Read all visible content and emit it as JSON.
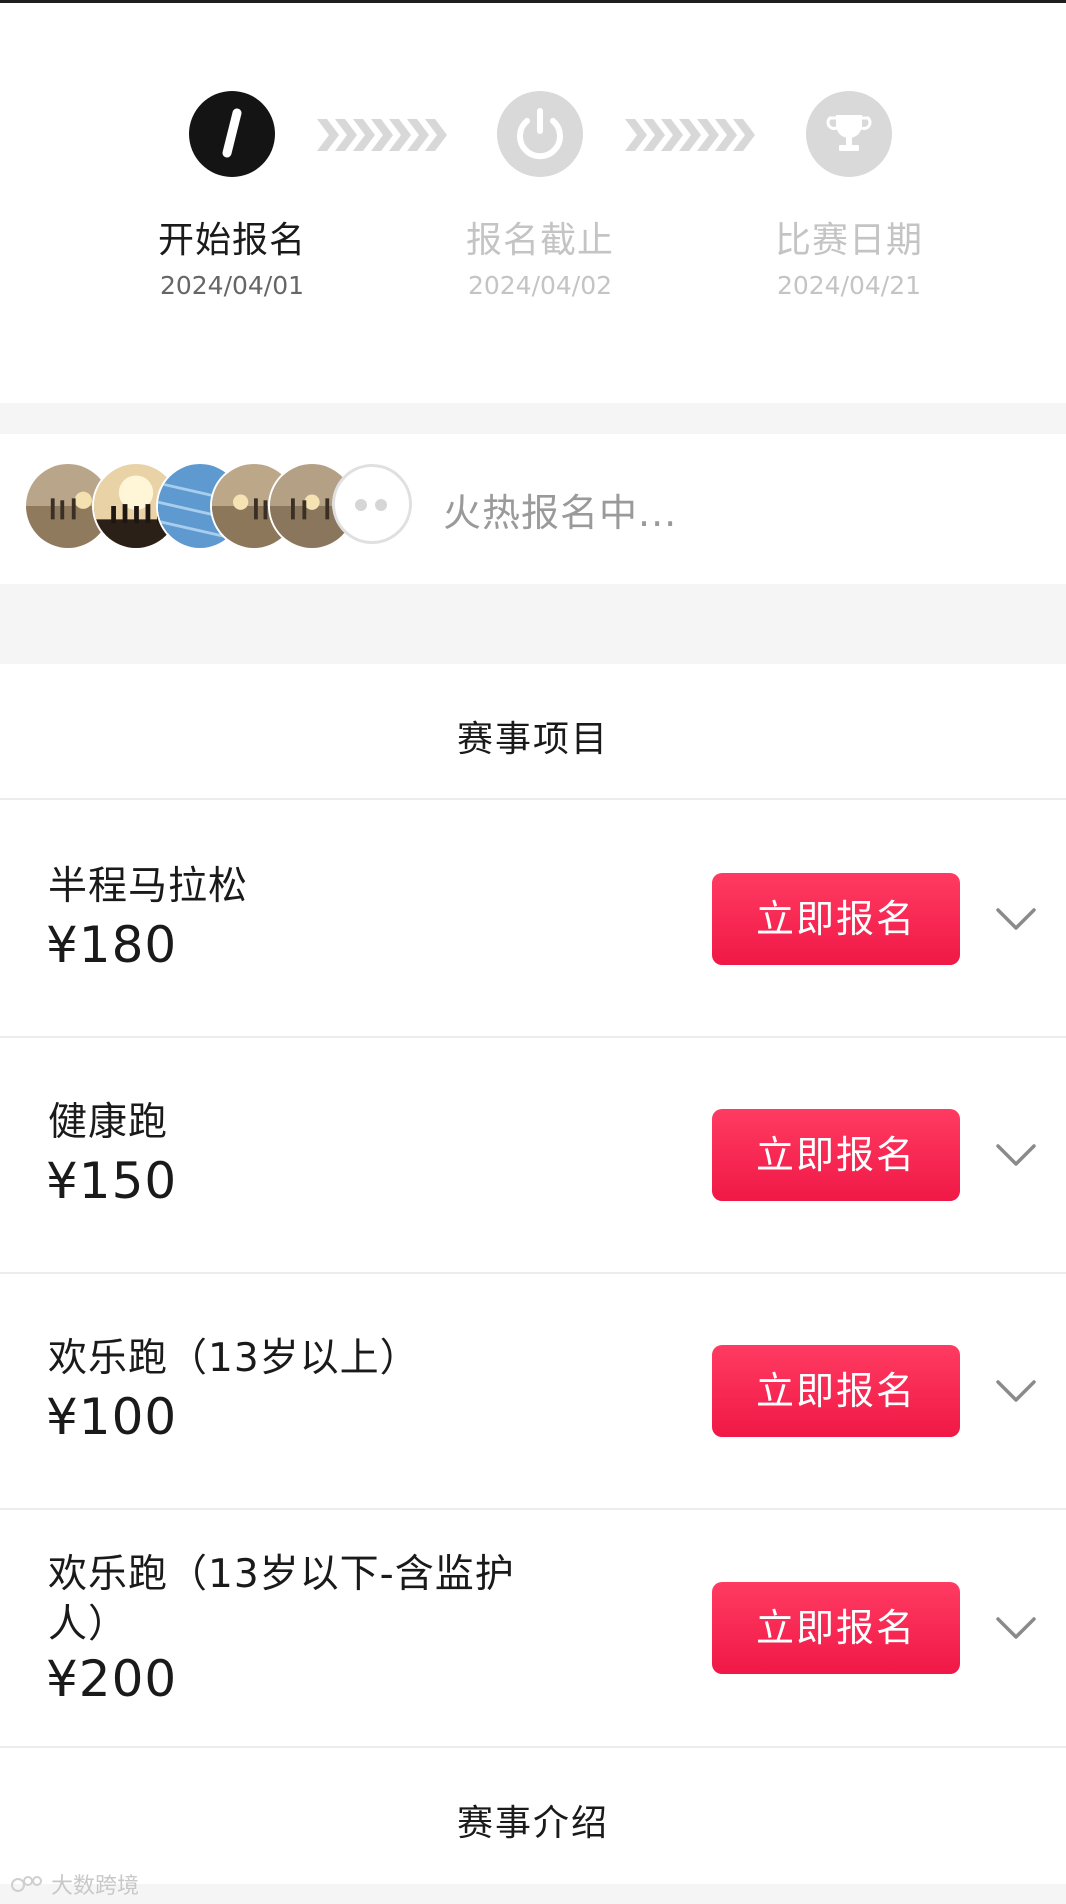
{
  "timeline": {
    "steps": [
      {
        "label": "开始报名",
        "date": "2024/04/01",
        "state": "active",
        "icon": "pen-icon"
      },
      {
        "label": "报名截止",
        "date": "2024/04/02",
        "state": "inactive",
        "icon": "power-icon"
      },
      {
        "label": "比赛日期",
        "date": "2024/04/21",
        "state": "inactive",
        "icon": "trophy-icon"
      }
    ]
  },
  "participants": {
    "status_text": "火热报名中...",
    "avatar_count_shown": 5
  },
  "events_section": {
    "title": "赛事项目",
    "items": [
      {
        "name": "半程马拉松",
        "price": "¥180",
        "button": "立即报名"
      },
      {
        "name": "健康跑",
        "price": "¥150",
        "button": "立即报名"
      },
      {
        "name": "欢乐跑（13岁以上）",
        "price": "¥100",
        "button": "立即报名"
      },
      {
        "name": "欢乐跑（13岁以下-含监护人）",
        "price": "¥200",
        "button": "立即报名"
      }
    ]
  },
  "intro_section": {
    "title": "赛事介绍"
  },
  "watermark": "大数跨境",
  "colors": {
    "accent": "#f01846",
    "active_step": "#141414",
    "inactive_step": "#d9d9d9",
    "muted_text": "#9a9a9a"
  }
}
